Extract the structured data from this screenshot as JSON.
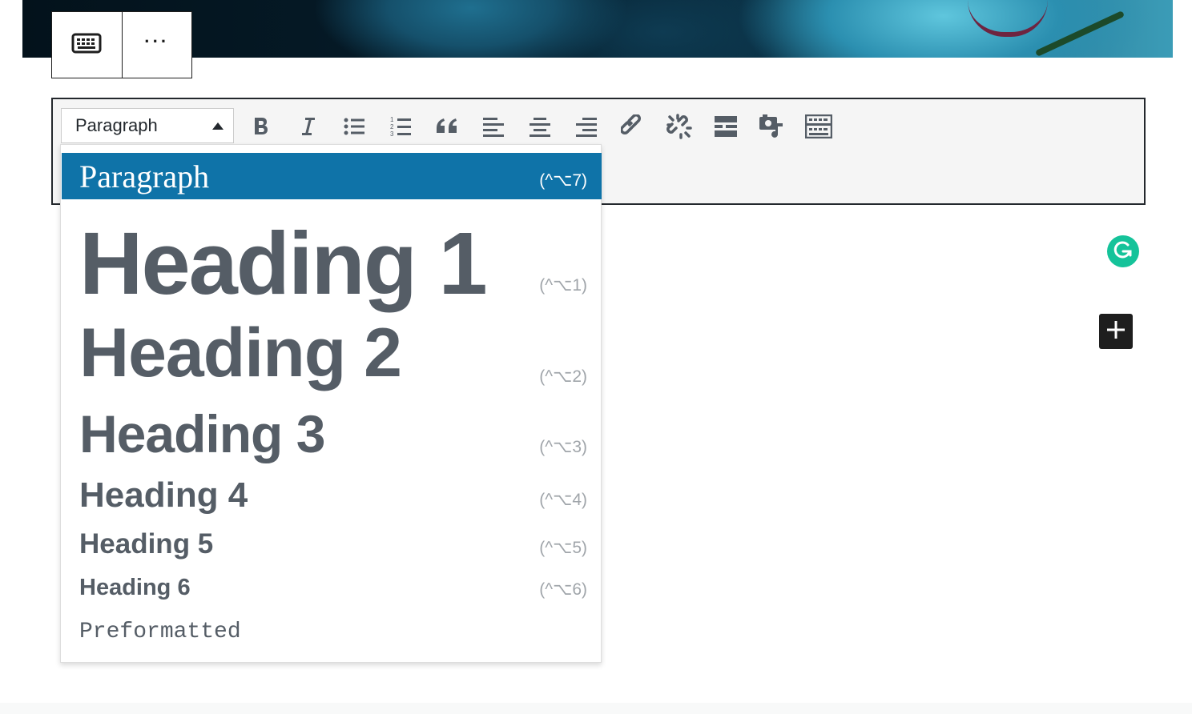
{
  "block_toolbar": {
    "keyboard_icon": "keyboard-icon",
    "more_label": "···"
  },
  "classic_toolbar": {
    "format_select": {
      "value": "Paragraph"
    },
    "tools": [
      "bold-icon",
      "italic-icon",
      "bulleted-list-icon",
      "numbered-list-icon",
      "blockquote-icon",
      "align-left-icon",
      "align-center-icon",
      "align-right-icon",
      "insert-link-icon",
      "remove-link-icon",
      "read-more-icon",
      "add-media-icon",
      "toolbar-toggle-icon"
    ]
  },
  "format_menu": {
    "options": [
      {
        "label": "Paragraph",
        "shortcut": "(^⌥7)",
        "selected": true
      },
      {
        "label": "Heading 1",
        "shortcut": "(^⌥1)"
      },
      {
        "label": "Heading 2",
        "shortcut": "(^⌥2)"
      },
      {
        "label": "Heading 3",
        "shortcut": "(^⌥3)"
      },
      {
        "label": "Heading 4",
        "shortcut": "(^⌥4)"
      },
      {
        "label": "Heading 5",
        "shortcut": "(^⌥5)"
      },
      {
        "label": "Heading 6",
        "shortcut": "(^⌥6)"
      },
      {
        "label": "Preformatted",
        "shortcut": ""
      }
    ]
  },
  "side_controls": {
    "grammarly_icon": "grammarly-icon",
    "add_block_icon": "plus-icon"
  },
  "colors": {
    "selected_bg": "#0f73a8",
    "grammarly": "#15c39a",
    "toolbar_bg": "#f5f5f5"
  }
}
